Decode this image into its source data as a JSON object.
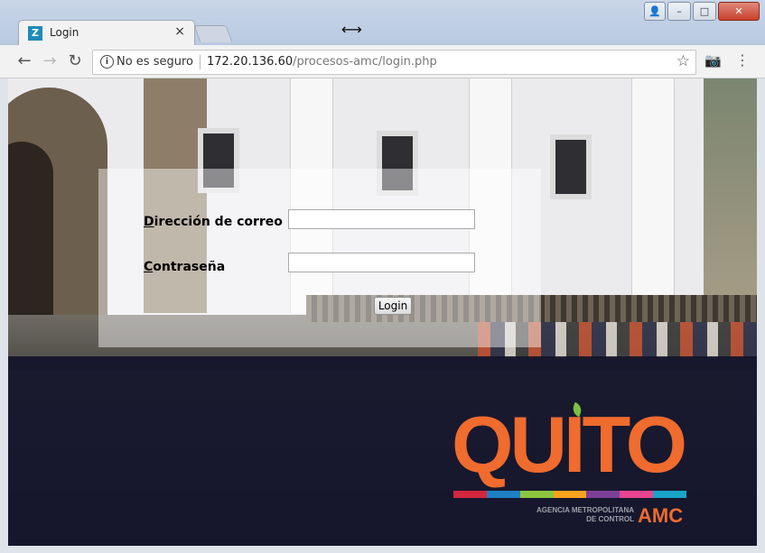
{
  "browser": {
    "tab": {
      "favicon": "Z",
      "title": "Login",
      "close": "×"
    },
    "window_controls": {
      "user": "👤",
      "minimize": "–",
      "maximize": "□",
      "close": "✕"
    },
    "nav": {
      "back": "←",
      "forward": "→",
      "reload": "↻"
    },
    "address": {
      "info": "i",
      "security": "No es seguro",
      "host": "172.20.136.60",
      "path": "/procesos-amc/login.php"
    },
    "star": "☆",
    "camera": "📷",
    "menu": "⋮",
    "cursor": "⟷"
  },
  "login": {
    "email_label_first": "D",
    "email_label_rest": "irección de correo",
    "email_value": "",
    "password_label_first": "C",
    "password_label_rest": "ontraseña",
    "password_value": "",
    "submit_label": "Login"
  },
  "logo": {
    "word": "QUITO",
    "subtitle_line1": "AGENCIA METROPOLITANA",
    "subtitle_line2": "DE CONTROL",
    "amc": "AMC",
    "stripe_colors": [
      "#d3263f",
      "#1e7fc3",
      "#8cc63f",
      "#f7a21b",
      "#7b3f98",
      "#e8448f",
      "#1aa3c9"
    ],
    "brand_color": "#ef6b2e"
  }
}
